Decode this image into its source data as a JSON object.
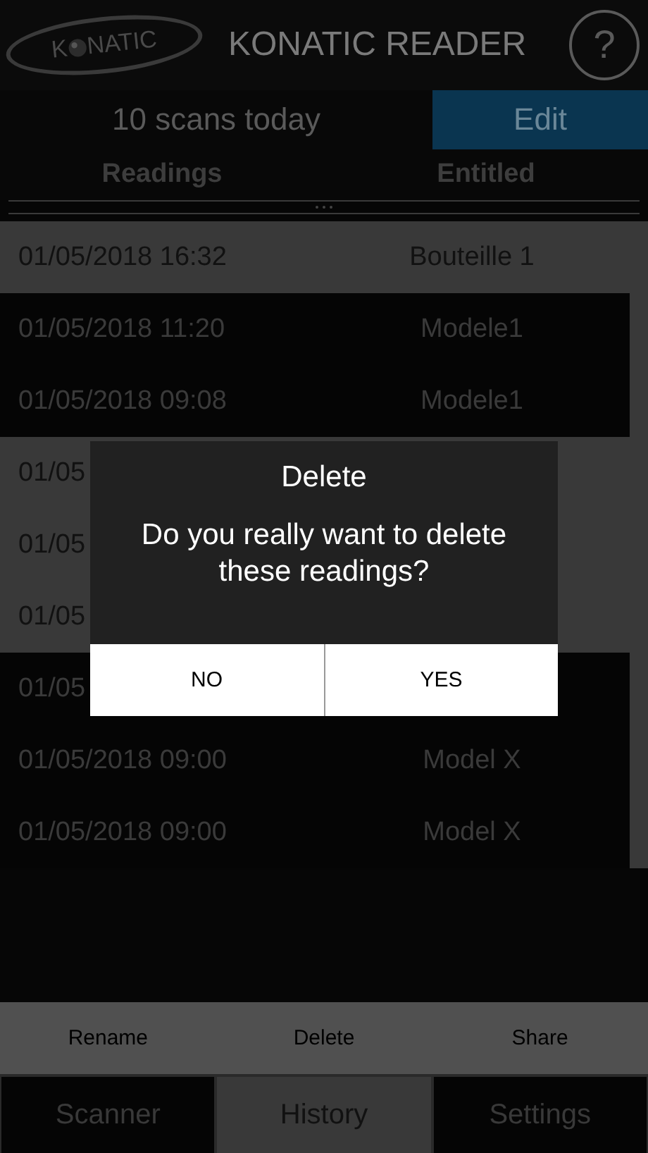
{
  "header": {
    "logo_left": "K",
    "logo_right": "NATIC",
    "title": "KONATIC READER",
    "help": "?"
  },
  "toolbar": {
    "scan_count": "10 scans today",
    "edit_button": "Edit"
  },
  "table": {
    "columns": [
      "Readings",
      "Entitled"
    ],
    "rows": [
      {
        "reading": "01/05/2018 16:32",
        "entitled": "Bouteille 1",
        "selected": true
      },
      {
        "reading": "01/05/2018 11:20",
        "entitled": "Modele1",
        "selected": false
      },
      {
        "reading": "01/05/2018 09:08",
        "entitled": "Modele1",
        "selected": false
      },
      {
        "reading": "01/05",
        "selected": true
      },
      {
        "reading": "01/05",
        "selected": true
      },
      {
        "reading": "01/05",
        "selected": true
      },
      {
        "reading": "01/05",
        "selected": false
      },
      {
        "reading": "01/05/2018 09:00",
        "entitled": "Model X",
        "selected": false
      },
      {
        "reading": "01/05/2018 09:00",
        "entitled": "Model X",
        "selected": false
      }
    ]
  },
  "actions": [
    "Rename",
    "Delete",
    "Share"
  ],
  "tabs": [
    {
      "label": "Scanner",
      "selected": false
    },
    {
      "label": "History",
      "selected": true
    },
    {
      "label": "Settings",
      "selected": false
    }
  ],
  "dialog": {
    "title": "Delete",
    "message": "Do you really want to delete these readings?",
    "buttons": [
      "NO",
      "YES"
    ]
  }
}
